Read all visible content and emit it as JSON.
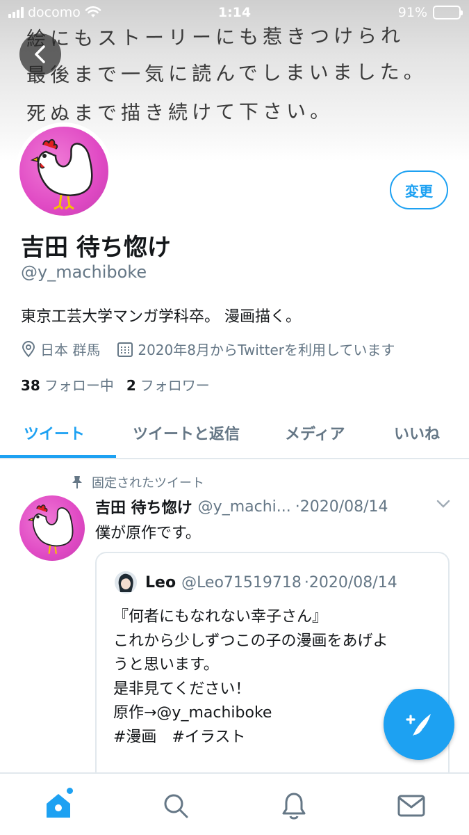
{
  "status_bar": {
    "carrier": "docomo",
    "time": "1:14",
    "battery": "91%",
    "battery_level": 0.91
  },
  "banner": {
    "handwriting": [
      "絵にもストーリーにも惹きつけられ",
      "最後まで一気に読んでしまいました。",
      "死ぬまで描き続けて下さい。"
    ]
  },
  "profile": {
    "edit_label": "変更",
    "name": "吉田 待ち惚け",
    "handle": "@y_machiboke",
    "bio": "東京工芸大学マンガ学科卒。 漫画描く。",
    "location": "日本 群馬",
    "joined": "2020年8月からTwitterを利用しています",
    "following_count": "38",
    "following_label": "フォロー中",
    "followers_count": "2",
    "followers_label": "フォロワー"
  },
  "tabs": [
    {
      "label": "ツイート"
    },
    {
      "label": "ツイートと返信"
    },
    {
      "label": "メディア"
    },
    {
      "label": "いいね"
    }
  ],
  "pinned_tweet": {
    "pinned_label": "固定されたツイート",
    "author_name": "吉田 待ち惚け",
    "author_handle": "@y_machi...",
    "date": "·2020/08/14",
    "text": "僕が原作です。",
    "quote": {
      "author_name": "Leo",
      "author_handle": "@Leo71519718",
      "date": "·2020/08/14",
      "lines": [
        "『何者にもなれない幸子さん』",
        "これから少しずつこの子の漫画をあげよ",
        "うと思います。",
        "是非見てください！",
        "原作→@y_machiboke",
        "#漫画　#イラスト"
      ]
    }
  },
  "colors": {
    "accent": "#1da1f2",
    "avatar_bg": "#e04ac4",
    "muted": "#657786"
  },
  "icons": [
    "back-icon",
    "location-icon",
    "calendar-icon",
    "pin-icon",
    "chevron-down-icon",
    "compose-icon",
    "home-icon",
    "search-icon",
    "notifications-icon",
    "messages-icon"
  ]
}
